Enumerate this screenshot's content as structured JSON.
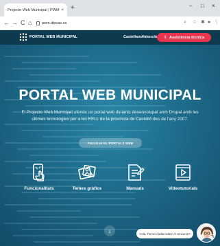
{
  "browser": {
    "tab_title": "Projecte Web Municipal | PWM",
    "tab_close": "×",
    "new_tab": "+",
    "url": "pwm.dipcas.es",
    "window_controls": {
      "minimize": "–",
      "maximize": "□",
      "close": "×"
    },
    "nav": {
      "back": "←",
      "forward": "→",
      "reload": "C",
      "home": "⌂"
    }
  },
  "site_header": {
    "logo_text": "PORTAL WEB MUNICIPAL",
    "lang_castellano": "Castellano",
    "lang_valencia": "Valencià",
    "assist_icon": "⇩",
    "assist_label": "Assistència tècnica"
  },
  "hero": {
    "title": "PORTAL WEB MUNICIPAL",
    "description": "El Projecte Web Municipal ofereix un portal web dinàmic desenvolupat amb Drupal amb les últimes tecnologies per a les EELL de la província de Castelló des de l'any 2007.",
    "cta_label": "FULLEJA EL PORTALS WEB"
  },
  "features": [
    {
      "label": "Funcionalitats",
      "icon": "touch-phone-icon"
    },
    {
      "label": "Temes gràfics",
      "icon": "images-icon"
    },
    {
      "label": "Manuals",
      "icon": "document-edit-icon"
    },
    {
      "label": "Videotutorials",
      "icon": "video-icon"
    }
  ],
  "scroll_arrow": "↓",
  "chat": {
    "bubble_text": "Hola, Tienes dudas sobre el concurso?"
  },
  "colors": {
    "header_bg": "#0e3a4f",
    "page_bg": "#1d6a89",
    "accent_red": "#e8354f"
  }
}
